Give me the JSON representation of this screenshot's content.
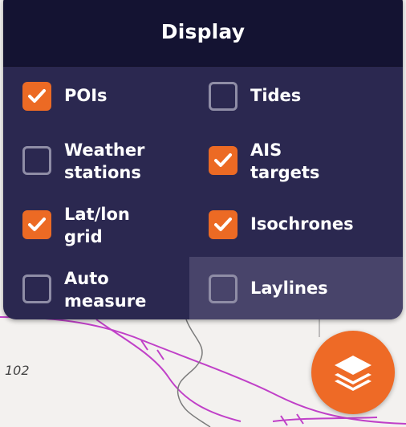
{
  "panel": {
    "title": "Display"
  },
  "options": [
    {
      "id": "pois",
      "label": "POIs",
      "checked": true
    },
    {
      "id": "tides",
      "label": "Tides",
      "checked": false
    },
    {
      "id": "weather-stations",
      "label": "Weather\nstations",
      "checked": false
    },
    {
      "id": "ais-targets",
      "label": "AIS\ntargets",
      "checked": true
    },
    {
      "id": "lat-lon-grid",
      "label": "Lat/lon\ngrid",
      "checked": true
    },
    {
      "id": "isochrones",
      "label": "Isochrones",
      "checked": true
    },
    {
      "id": "auto-measure",
      "label": "Auto\nmeasure",
      "checked": false
    },
    {
      "id": "laylines",
      "label": "Laylines",
      "checked": false
    }
  ],
  "map": {
    "depth_label": "102"
  },
  "layers_button": {
    "icon": "layers-icon"
  },
  "colors": {
    "panel_bg": "#2b2850",
    "header_bg": "#141332",
    "accent": "#ec6a24",
    "checkbox_border": "#8f8da6",
    "route_line": "#c040c8"
  }
}
